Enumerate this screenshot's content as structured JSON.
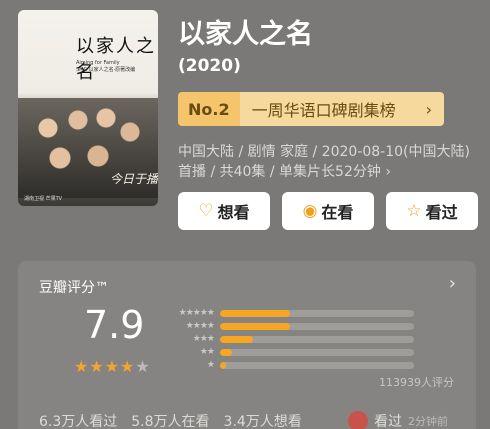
{
  "poster": {
    "title": "以家人之名",
    "signature": "今日于播",
    "credits": "Aiming for Family",
    "subtitle": "SMC·以家人之名·原著改编",
    "logos": "湖南卫视 芒果TV"
  },
  "movie": {
    "title": "以家人之名",
    "year": "(2020)"
  },
  "rank": {
    "number": "No.2",
    "text": "一周华语口碑剧集榜",
    "chevron": "›"
  },
  "meta": "中国大陆 / 剧情 家庭 / 2020-08-10(中国大陆)首播 / 共40集 / 单集片长52分钟 ›",
  "actions": [
    {
      "label": "想看",
      "icon": "heart-plus-icon"
    },
    {
      "label": "在看",
      "icon": "target-icon"
    },
    {
      "label": "看过",
      "icon": "star-outline-icon"
    }
  ],
  "rating": {
    "label": "豆瓣评分™",
    "more": "›",
    "score": "7.9",
    "stars": 4,
    "count_text": "113939人评分",
    "distribution": [
      {
        "stars": 5,
        "pct": 36
      },
      {
        "stars": 4,
        "pct": 36
      },
      {
        "stars": 3,
        "pct": 17
      },
      {
        "stars": 2,
        "pct": 6
      },
      {
        "stars": 1,
        "pct": 3
      }
    ]
  },
  "stats": [
    "6.3万人看过",
    "5.8万人在看",
    "3.4万人想看"
  ],
  "recent": {
    "action": "看过",
    "time": "2分钟前"
  },
  "colors": {
    "background": "#7a7977",
    "accent": "#f5a623",
    "rank_bg": "#f6d99c"
  }
}
